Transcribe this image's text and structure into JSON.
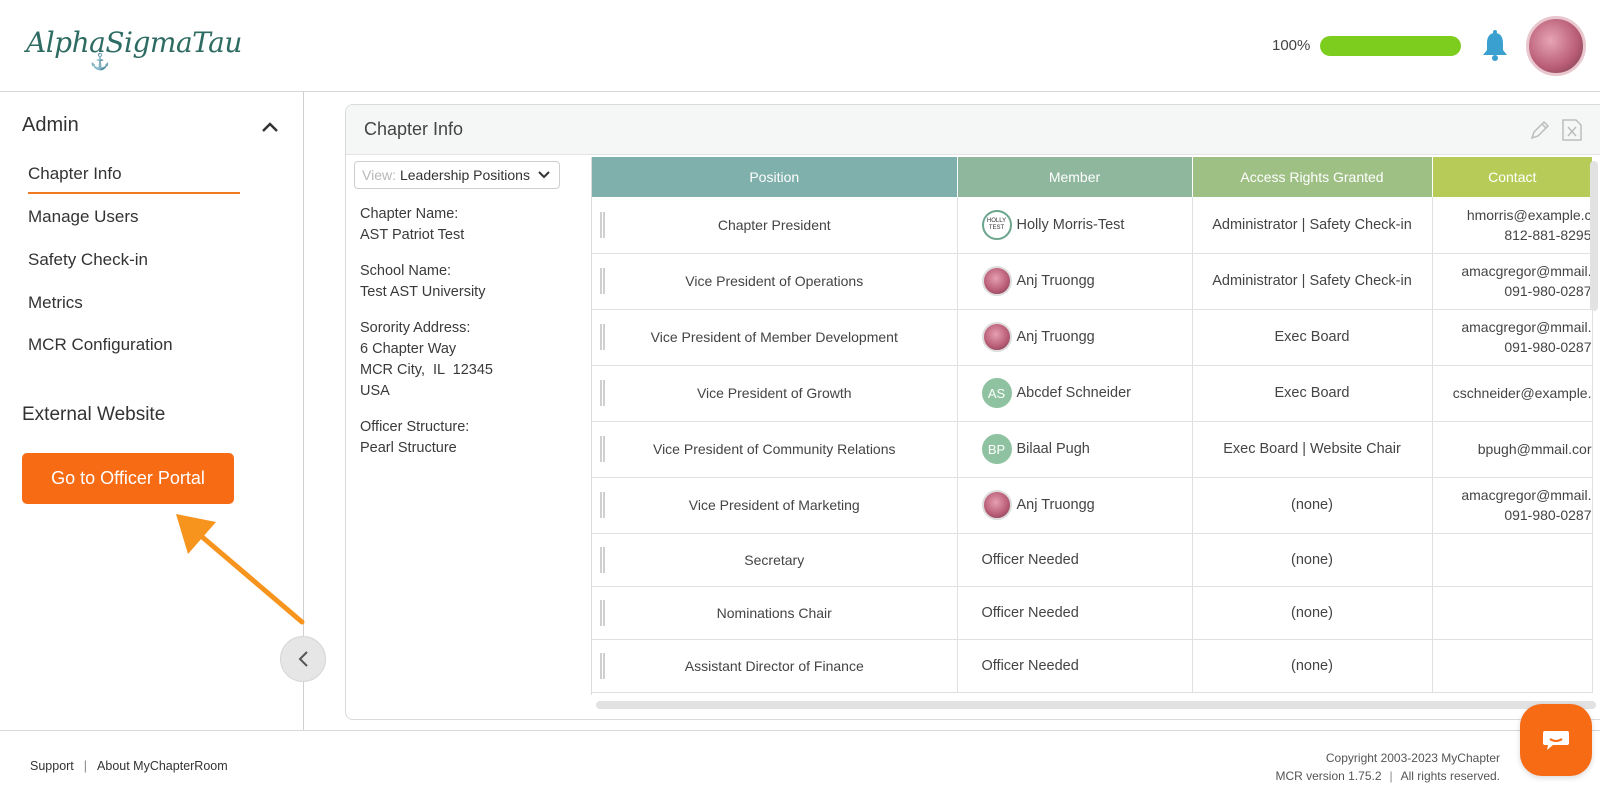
{
  "brand": {
    "logo_text": "AlphaSigmaTau",
    "logo_mark": "⚓"
  },
  "header": {
    "progress_label": "100%",
    "progress_value": 1.0
  },
  "sidebar": {
    "section_title": "Admin",
    "items": [
      {
        "label": "Chapter Info",
        "active": true
      },
      {
        "label": "Manage Users"
      },
      {
        "label": "Safety Check-in"
      },
      {
        "label": "Metrics"
      },
      {
        "label": "MCR Configuration"
      }
    ],
    "external_title": "External Website",
    "portal_button": "Go to Officer Portal"
  },
  "panel": {
    "title": "Chapter Info",
    "view_label": "View:",
    "view_value": "Leadership Positions",
    "info": [
      {
        "label": "Chapter Name:",
        "lines": [
          "AST Patriot Test"
        ]
      },
      {
        "label": "School Name:",
        "lines": [
          "Test AST University"
        ]
      },
      {
        "label": "Sorority Address:",
        "lines": [
          "6 Chapter Way",
          "MCR City,  IL  12345",
          "USA"
        ]
      },
      {
        "label": "Officer Structure:",
        "lines": [
          "Pearl Structure"
        ]
      }
    ]
  },
  "table": {
    "headers": {
      "position": "Position",
      "member": "Member",
      "access": "Access Rights Granted",
      "contact": "Contact"
    },
    "rows": [
      {
        "position": "Chapter President",
        "member": "Holly Morris-Test",
        "avatar": "holly",
        "avatar_text": "HOLLY TEST",
        "access": "Administrator | Safety Check-in",
        "email": "hmorris@example.c",
        "phone": "812-881-8295"
      },
      {
        "position": "Vice President of Operations",
        "member": "Anj Truongg",
        "avatar": "photo",
        "avatar_text": "",
        "access": "Administrator | Safety Check-in",
        "email": "amacgregor@mmail.",
        "phone": "091-980-0287"
      },
      {
        "position": "Vice President of Member Development",
        "member": "Anj Truongg",
        "avatar": "photo",
        "avatar_text": "",
        "access": "Exec Board",
        "email": "amacgregor@mmail.",
        "phone": "091-980-0287"
      },
      {
        "position": "Vice President of Growth",
        "member": "Abcdef Schneider",
        "avatar": "init",
        "avatar_text": "AS",
        "access": "Exec Board",
        "email": "cschneider@example.",
        "phone": ""
      },
      {
        "position": "Vice President of Community Relations",
        "member": "Bilaal Pugh",
        "avatar": "init",
        "avatar_text": "BP",
        "access": "Exec Board | Website Chair",
        "email": "bpugh@mmail.cor",
        "phone": ""
      },
      {
        "position": "Vice President of Marketing",
        "member": "Anj Truongg",
        "avatar": "photo",
        "avatar_text": "",
        "access": "(none)",
        "email": "amacgregor@mmail.",
        "phone": "091-980-0287"
      },
      {
        "position": "Secretary",
        "member": "Officer Needed",
        "avatar": "none",
        "avatar_text": "",
        "access": "(none)",
        "email": "",
        "phone": ""
      },
      {
        "position": "Nominations Chair",
        "member": "Officer Needed",
        "avatar": "none",
        "avatar_text": "",
        "access": "(none)",
        "email": "",
        "phone": ""
      },
      {
        "position": "Assistant Director of Finance",
        "member": "Officer Needed",
        "avatar": "none",
        "avatar_text": "",
        "access": "(none)",
        "email": "",
        "phone": ""
      }
    ]
  },
  "footer": {
    "links": [
      "Support",
      "About MyChapterRoom"
    ],
    "separator": "|",
    "copyright": "Copyright 2003-2023 MyChapter",
    "version": "MCR version 1.75.2",
    "version_sep": "|",
    "rights": "All rights reserved."
  },
  "colors": {
    "accent": "#f76b14",
    "progress": "#7ccd1e",
    "header_pos": "#7fb0ab",
    "header_member": "#8fb79d",
    "header_access": "#9fc085",
    "header_contact": "#b7cc58"
  },
  "icons": [
    "bell-icon",
    "chevron-up-icon",
    "chevron-left-icon",
    "edit-icon",
    "excel-export-icon",
    "chat-icon",
    "arrow-pointer-icon"
  ]
}
